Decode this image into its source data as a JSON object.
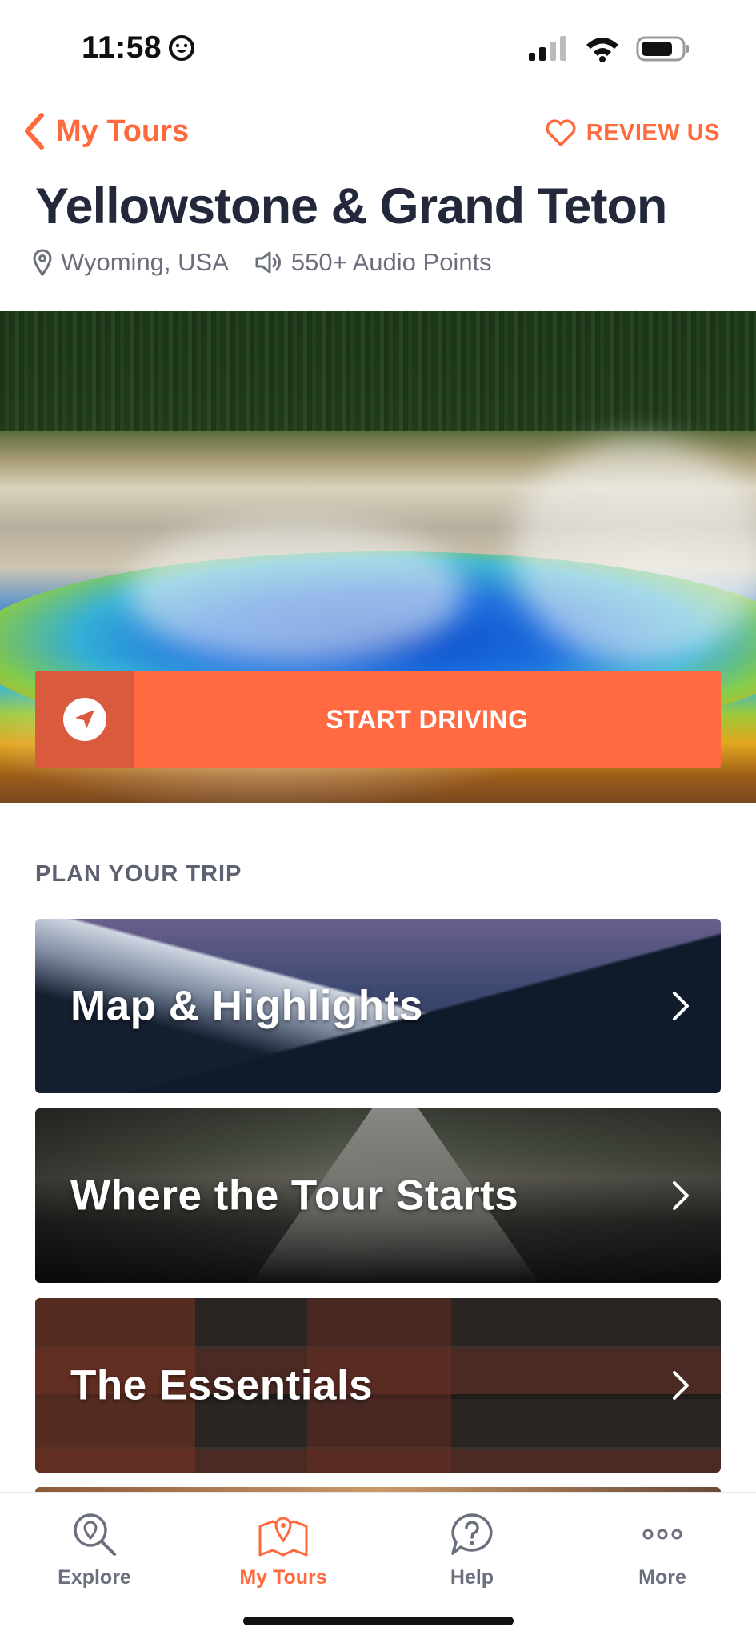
{
  "status_bar": {
    "time": "11:58"
  },
  "header": {
    "back_label": "My Tours",
    "review_label": "REVIEW US"
  },
  "tour": {
    "title": "Yellowstone & Grand Teton",
    "location": "Wyoming, USA",
    "audio_points": "550+ Audio Points"
  },
  "hero": {
    "start_label": "START DRIVING"
  },
  "plan": {
    "section_title": "PLAN YOUR TRIP",
    "cards": [
      {
        "label": "Map & Highlights"
      },
      {
        "label": "Where the Tour Starts"
      },
      {
        "label": "The Essentials"
      }
    ]
  },
  "tab_bar": {
    "tabs": [
      {
        "label": "Explore",
        "icon": "explore-icon"
      },
      {
        "label": "My Tours",
        "icon": "map-pin-icon",
        "active": true
      },
      {
        "label": "Help",
        "icon": "help-icon"
      },
      {
        "label": "More",
        "icon": "more-icon"
      }
    ]
  },
  "colors": {
    "accent": "#ff6a3d",
    "title": "#23283a",
    "muted": "#6b6f7d"
  }
}
